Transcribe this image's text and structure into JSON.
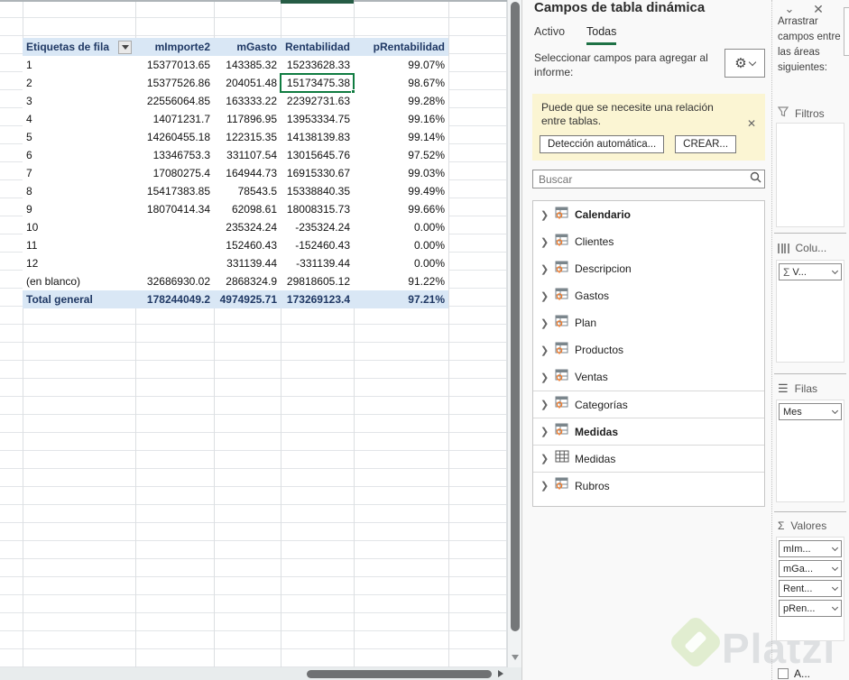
{
  "accent_colors": {
    "excel_green": "#107C41",
    "tab_underline": "#1E7145",
    "header_blue": "#D9E7F5",
    "header_text": "#1F3864",
    "warning_bg": "#FBF5D3"
  },
  "pivot": {
    "columns": [
      "Etiquetas de fila",
      "mImporte2",
      "mGasto",
      "Rentabilidad",
      "pRentabilidad"
    ],
    "rows": [
      [
        "1",
        "15377013.65",
        "143385.32",
        "15233628.33",
        "99.07%"
      ],
      [
        "2",
        "15377526.86",
        "204051.48",
        "15173475.38",
        "98.67%"
      ],
      [
        "3",
        "22556064.85",
        "163333.22",
        "22392731.63",
        "99.28%"
      ],
      [
        "4",
        "14071231.7",
        "117896.95",
        "13953334.75",
        "99.16%"
      ],
      [
        "5",
        "14260455.18",
        "122315.35",
        "14138139.83",
        "99.14%"
      ],
      [
        "6",
        "13346753.3",
        "331107.54",
        "13015645.76",
        "97.52%"
      ],
      [
        "7",
        "17080275.4",
        "164944.73",
        "16915330.67",
        "99.03%"
      ],
      [
        "8",
        "15417383.85",
        "78543.5",
        "15338840.35",
        "99.49%"
      ],
      [
        "9",
        "18070414.34",
        "62098.61",
        "18008315.73",
        "99.66%"
      ],
      [
        "10",
        "",
        "235324.24",
        "-235324.24",
        "0.00%"
      ],
      [
        "11",
        "",
        "152460.43",
        "-152460.43",
        "0.00%"
      ],
      [
        "12",
        "",
        "331139.44",
        "-331139.44",
        "0.00%"
      ],
      [
        "(en blanco)",
        "32686930.02",
        "2868324.9",
        "29818605.12",
        "91.22%"
      ]
    ],
    "total": [
      "Total general",
      "178244049.2",
      "4974925.71",
      "173269123.4",
      "97.21%"
    ]
  },
  "pane": {
    "title": "Campos de tabla dinámica",
    "tab_activo": "Activo",
    "tab_todas": "Todas",
    "select_text": "Seleccionar campos para agregar al informe:",
    "warning": {
      "text": "Puede que se necesite una relación entre tablas.",
      "detect_button": "Detección automática...",
      "create_button": "CREAR..."
    },
    "search_placeholder": "Buscar",
    "fields": [
      "Calendario",
      "Clientes",
      "Descripcion",
      "Gastos",
      "Plan",
      "Productos",
      "Ventas",
      "Categorías",
      "Medidas",
      "Medidas",
      "Rubros"
    ],
    "drag_hint": "Arrastrar campos entre las áreas siguientes:",
    "areas": {
      "filtros_label": "Filtros",
      "columnas_label": "Colu...",
      "filas_label": "Filas",
      "valores_label": "Valores",
      "sigma": "Σ",
      "columnas_item": "V...",
      "filas_item": "Mes",
      "valores_items": [
        "mIm...",
        "mGa...",
        "Rent...",
        "pRen..."
      ]
    },
    "defer_label": "A...",
    "gear_icon": "⚙",
    "close_icon": "✕",
    "chevron_icon": "⌄",
    "search_icon": "⌕",
    "warn_close_icon": "✕"
  },
  "watermark": {
    "brand": "Platzi"
  }
}
